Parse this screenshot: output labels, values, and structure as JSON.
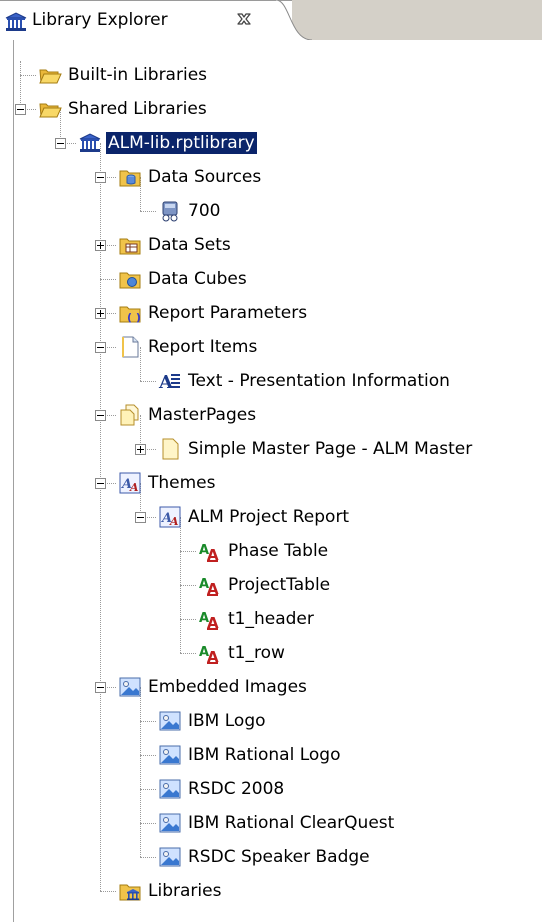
{
  "tab": {
    "title": "Library Explorer",
    "icon": "library-icon",
    "close_icon": "close-icon"
  },
  "tree": [
    {
      "label": "Built-in Libraries",
      "icon": "folder-open-icon",
      "depth": 0,
      "expander": "none"
    },
    {
      "label": "Shared Libraries",
      "icon": "folder-open-icon",
      "depth": 0,
      "expander": "minus"
    },
    {
      "label": "ALM-lib.rptlibrary",
      "icon": "library-icon",
      "depth": 1,
      "expander": "minus",
      "selected": true
    },
    {
      "label": "Data Sources",
      "icon": "data-sources-folder-icon",
      "depth": 2,
      "expander": "minus"
    },
    {
      "label": "700",
      "icon": "data-source-icon",
      "depth": 3,
      "expander": "none"
    },
    {
      "label": "Data Sets",
      "icon": "data-sets-folder-icon",
      "depth": 2,
      "expander": "plus"
    },
    {
      "label": "Data Cubes",
      "icon": "data-cubes-folder-icon",
      "depth": 2,
      "expander": "none"
    },
    {
      "label": "Report Parameters",
      "icon": "report-parameters-folder-icon",
      "depth": 2,
      "expander": "plus"
    },
    {
      "label": "Report Items",
      "icon": "report-items-icon",
      "depth": 2,
      "expander": "minus"
    },
    {
      "label": "Text - Presentation Information",
      "icon": "text-item-icon",
      "depth": 3,
      "expander": "none"
    },
    {
      "label": "MasterPages",
      "icon": "master-pages-icon",
      "depth": 2,
      "expander": "minus"
    },
    {
      "label": "Simple Master Page - ALM Master",
      "icon": "master-page-icon",
      "depth": 3,
      "expander": "plus"
    },
    {
      "label": "Themes",
      "icon": "themes-icon",
      "depth": 2,
      "expander": "minus"
    },
    {
      "label": "ALM Project Report",
      "icon": "theme-icon",
      "depth": 3,
      "expander": "minus"
    },
    {
      "label": "Phase Table",
      "icon": "style-icon",
      "depth": 4,
      "expander": "none"
    },
    {
      "label": "ProjectTable",
      "icon": "style-icon",
      "depth": 4,
      "expander": "none"
    },
    {
      "label": "t1_header",
      "icon": "style-icon",
      "depth": 4,
      "expander": "none"
    },
    {
      "label": "t1_row",
      "icon": "style-icon",
      "depth": 4,
      "expander": "none"
    },
    {
      "label": "Embedded Images",
      "icon": "embedded-images-icon",
      "depth": 2,
      "expander": "minus"
    },
    {
      "label": "IBM Logo",
      "icon": "image-icon",
      "depth": 3,
      "expander": "none"
    },
    {
      "label": "IBM Rational Logo",
      "icon": "image-icon",
      "depth": 3,
      "expander": "none"
    },
    {
      "label": "RSDC 2008",
      "icon": "image-icon",
      "depth": 3,
      "expander": "none"
    },
    {
      "label": "IBM Rational ClearQuest",
      "icon": "image-icon",
      "depth": 3,
      "expander": "none"
    },
    {
      "label": "RSDC Speaker Badge",
      "icon": "image-icon",
      "depth": 3,
      "expander": "none"
    },
    {
      "label": "Libraries",
      "icon": "libraries-folder-icon",
      "depth": 2,
      "expander": "none"
    }
  ],
  "colors": {
    "selection_bg": "#0a246a",
    "selection_fg": "#ffffff",
    "folder_yellow": "#f4c845",
    "tree_line": "#9a9a9a"
  }
}
